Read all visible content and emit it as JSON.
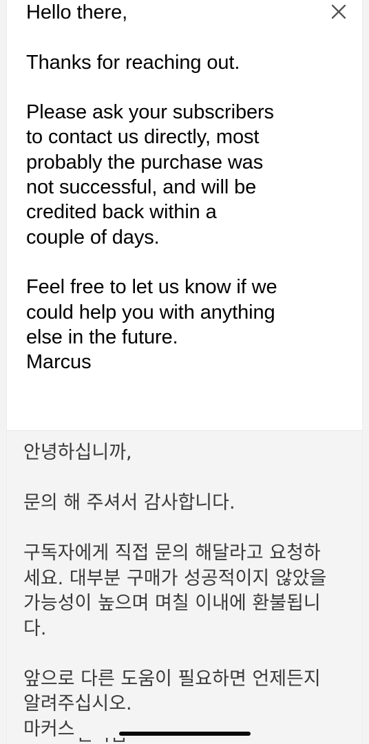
{
  "email": {
    "close_label": "×",
    "original": {
      "greeting": "Hello there,",
      "thanks": "Thanks for reaching out.",
      "body_lines": [
        "Please ask your subscribers",
        "to contact us directly, most",
        "probably the purchase was",
        "not successful, and will be",
        "credited back within a",
        "couple of days."
      ],
      "closing_lines": [
        "Feel free to let us know if we",
        "could help you with anything",
        "else in the future."
      ],
      "signature": "Marcus"
    },
    "translation": {
      "greeting": "안녕하십니까,",
      "thanks": "문의 해 주셔서 감사합니다.",
      "body_lines": [
        "구독자에게 직접 문의 해달라고 요청하",
        "세요. 대부분 구매가 성공적이지 않았을",
        "가능성이 높으며 며칠 이내에 환불됩니",
        "다."
      ],
      "closing_lines": [
        "앞으로 다른 도움이 필요하면 언제든지",
        "알려주십시오."
      ],
      "signature": "마커스",
      "cutoff_text": "번역됨"
    }
  }
}
